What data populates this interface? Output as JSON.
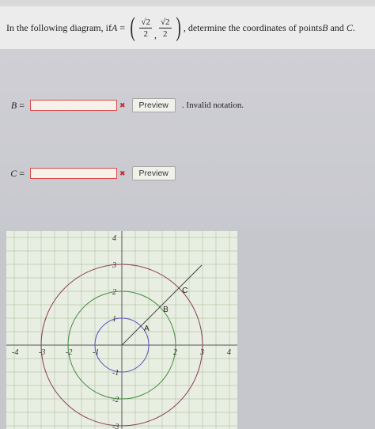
{
  "question": {
    "prefix": "In the following diagram, if ",
    "var_a": "A",
    "equals": " = ",
    "frac_num_1": "√2",
    "frac_den_1": "2",
    "comma": ",",
    "frac_num_2": "√2",
    "frac_den_2": "2",
    "suffix_1": ", determine the coordinates of points ",
    "var_b": "B",
    "and": " and ",
    "var_c": "C",
    "period": "."
  },
  "answers": {
    "b": {
      "label": "B",
      "eq": "=",
      "value": "",
      "preview": "Preview",
      "status": ". Invalid notation."
    },
    "c": {
      "label": "C",
      "eq": "=",
      "value": "",
      "preview": "Preview"
    }
  },
  "diagram": {
    "x_ticks": [
      "-4",
      "-3",
      "-2",
      "-1",
      "2",
      "3",
      "4"
    ],
    "y_ticks": [
      "4",
      "3",
      "2",
      "1",
      "-1",
      "-2",
      "-3"
    ],
    "points": [
      "A",
      "B",
      "C"
    ],
    "circle_radii": [
      1,
      2,
      3
    ],
    "circle_colors": [
      "#5a4fbf",
      "#3f8a3f",
      "#8a3f5a"
    ],
    "grid_color": "#b6c9a8",
    "ray_angle_deg": 45
  },
  "icons": {
    "error": "close-icon"
  }
}
